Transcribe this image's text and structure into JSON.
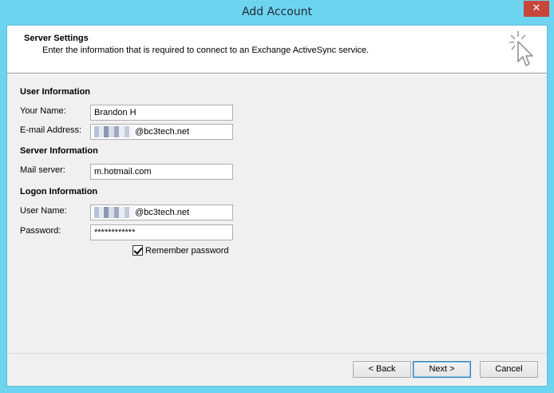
{
  "window": {
    "title": "Add Account",
    "close_glyph": "✕"
  },
  "header": {
    "title": "Server Settings",
    "description": "Enter the information that is required to connect to an Exchange ActiveSync service.",
    "icon": "cursor-sparkle-icon"
  },
  "user_info": {
    "section_title": "User Information",
    "name_label": "Your Name:",
    "name_value": "Brandon H",
    "email_label": "E-mail Address:",
    "email_value": "@bc3tech.net"
  },
  "server_info": {
    "section_title": "Server Information",
    "mail_server_label": "Mail server:",
    "mail_server_value": "m.hotmail.com"
  },
  "logon_info": {
    "section_title": "Logon Information",
    "user_name_label": "User Name:",
    "user_name_value": "@bc3tech.net",
    "password_label": "Password:",
    "password_value": "************",
    "remember_label": "Remember password",
    "remember_checked": true
  },
  "footer": {
    "back_label": "< Back",
    "next_label": "Next >",
    "cancel_label": "Cancel"
  }
}
